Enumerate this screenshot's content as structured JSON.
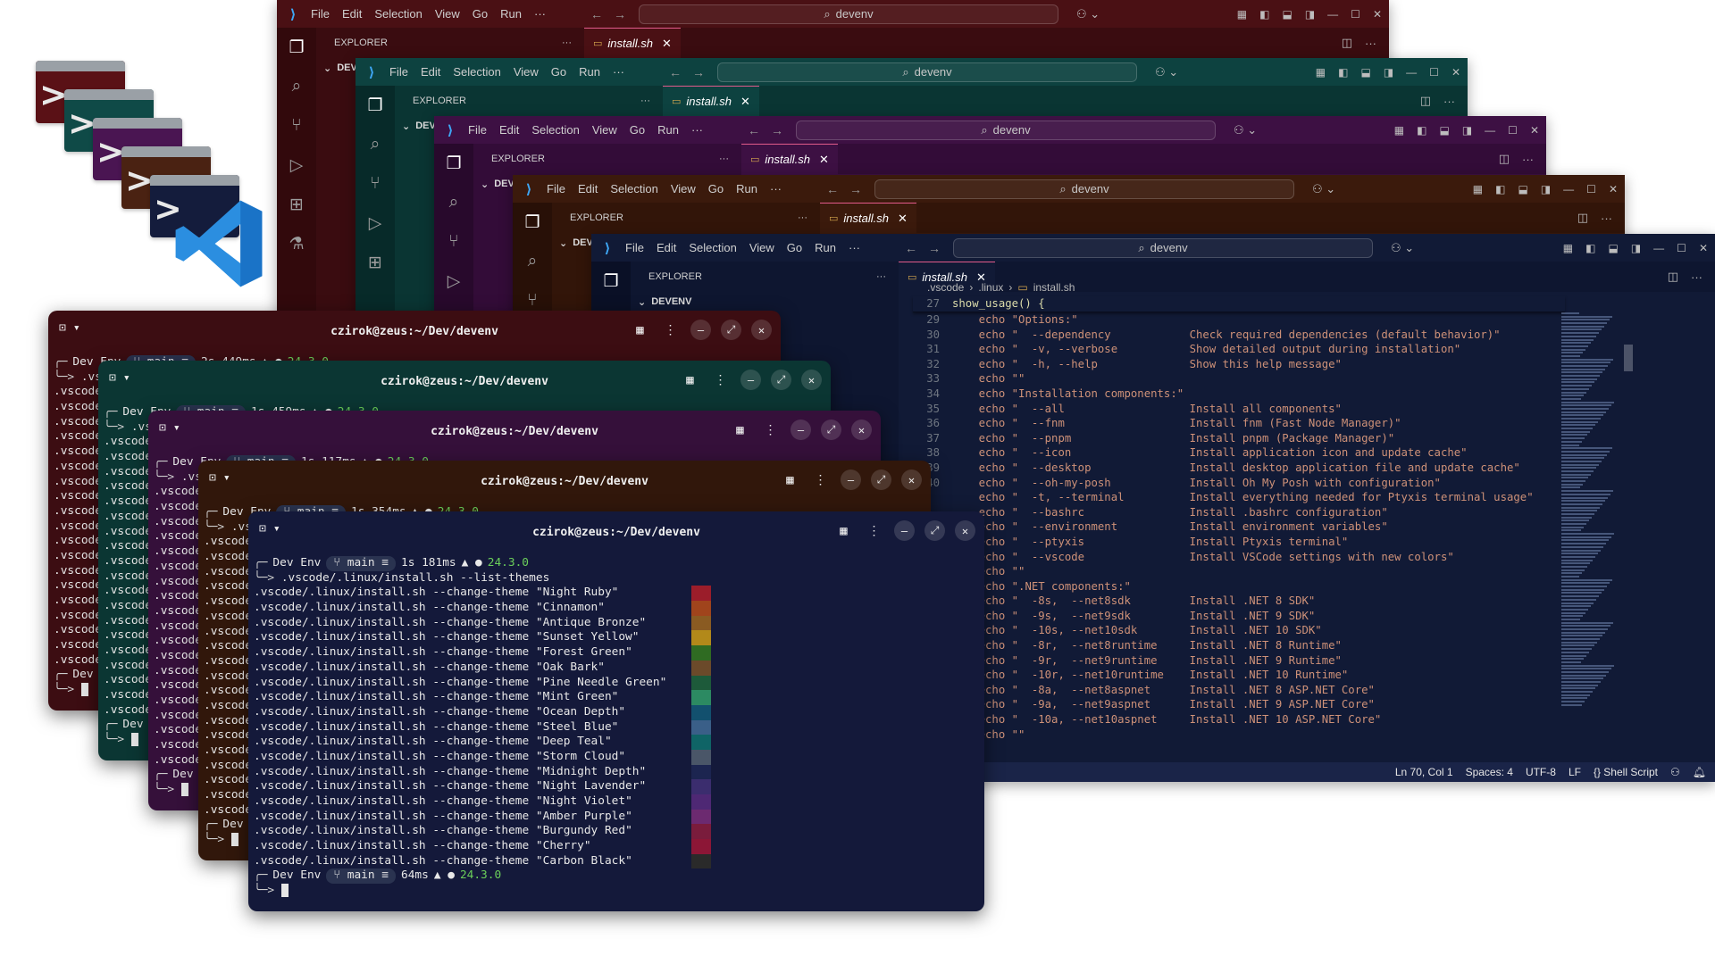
{
  "vscode": {
    "menu": [
      "File",
      "Edit",
      "Selection",
      "View",
      "Go",
      "Run"
    ],
    "more": "···",
    "search": "devenv",
    "explorer_title": "EXPLORER",
    "explorer_root": "DEVENV",
    "explorer_root_short": "DEVE",
    "tab_label": "install.sh",
    "breadcrumb": [
      ".vscode",
      ".linux",
      "install.sh"
    ],
    "sticky_line": {
      "num": "27",
      "text": "show_usage() {"
    },
    "code": [
      {
        "n": "29",
        "o": "echo \"Options:\"",
        "d": ""
      },
      {
        "n": "30",
        "o": "echo \"  --dependency",
        "d": "Check required dependencies (default behavior)\""
      },
      {
        "n": "31",
        "o": "echo \"  -v, --verbose",
        "d": "Show detailed output during installation\""
      },
      {
        "n": "32",
        "o": "echo \"  -h, --help",
        "d": "Show this help message\""
      },
      {
        "n": "33",
        "o": "echo \"\"",
        "d": ""
      },
      {
        "n": "34",
        "o": "echo \"Installation components:\"",
        "d": ""
      },
      {
        "n": "35",
        "o": "echo \"  --all",
        "d": "Install all components\""
      },
      {
        "n": "36",
        "o": "echo \"  --fnm",
        "d": "Install fnm (Fast Node Manager)\""
      },
      {
        "n": "37",
        "o": "echo \"  --pnpm",
        "d": "Install pnpm (Package Manager)\""
      },
      {
        "n": "38",
        "o": "echo \"  --icon",
        "d": "Install application icon and update cache\""
      },
      {
        "n": "39",
        "o": "echo \"  --desktop",
        "d": "Install desktop application file and update cache\""
      },
      {
        "n": "40",
        "o": "echo \"  --oh-my-posh",
        "d": "Install Oh My Posh with configuration\""
      },
      {
        "n": "",
        "o": "echo \"  -t, --terminal",
        "d": "Install everything needed for Ptyxis terminal usage\""
      },
      {
        "n": "",
        "o": "echo \"  --bashrc",
        "d": "Install .bashrc configuration\""
      },
      {
        "n": "",
        "o": "echo \"  --environment",
        "d": "Install environment variables\""
      },
      {
        "n": "",
        "o": "echo \"  --ptyxis",
        "d": "Install Ptyxis terminal\""
      },
      {
        "n": "",
        "o": "echo \"  --vscode",
        "d": "Install VSCode settings with new colors\""
      },
      {
        "n": "",
        "o": "echo \"\"",
        "d": ""
      },
      {
        "n": "",
        "o": "echo \".NET components:\"",
        "d": ""
      },
      {
        "n": "",
        "o": "echo \"  -8s,  --net8sdk",
        "d": "Install .NET 8 SDK\""
      },
      {
        "n": "",
        "o": "echo \"  -9s,  --net9sdk",
        "d": "Install .NET 9 SDK\""
      },
      {
        "n": "",
        "o": "echo \"  -10s, --net10sdk",
        "d": "Install .NET 10 SDK\""
      },
      {
        "n": "",
        "o": "echo \"  -8r,  --net8runtime",
        "d": "Install .NET 8 Runtime\""
      },
      {
        "n": "",
        "o": "echo \"  -9r,  --net9runtime",
        "d": "Install .NET 9 Runtime\""
      },
      {
        "n": "",
        "o": "echo \"  -10r, --net10runtime",
        "d": "Install .NET 10 Runtime\""
      },
      {
        "n": "",
        "o": "echo \"  -8a,  --net8aspnet",
        "d": "Install .NET 8 ASP.NET Core\""
      },
      {
        "n": "",
        "o": "echo \"  -9a,  --net9aspnet",
        "d": "Install .NET 9 ASP.NET Core\""
      },
      {
        "n": "",
        "o": "echo \"  -10a, --net10aspnet",
        "d": "Install .NET 10 ASP.NET Core\""
      },
      {
        "n": "",
        "o": "echo \"\"",
        "d": ""
      }
    ],
    "status": {
      "position": "Ln 70, Col 1",
      "spaces": "Spaces: 4",
      "encoding": "UTF-8",
      "eol": "LF",
      "language": "{} Shell Script"
    }
  },
  "terminal": {
    "title": "czirok@zeus:~/Dev/devenv",
    "prompt_dir": "Dev Env",
    "prompt_branch": "main ≡",
    "node_version": "24.3.0",
    "times": [
      "2s 449ms",
      "1s 459ms",
      "1s 117ms",
      "1s 354ms",
      "1s 181ms",
      "64ms"
    ],
    "command": ".vscode/.linux/install.sh --list-themes",
    "partial": ".vscode",
    "theme_prefix": ".vscode/.linux/install.sh --change-theme",
    "themes": [
      "Night Ruby",
      "Cinnamon",
      "Antique Bronze",
      "Sunset Yellow",
      "Forest Green",
      "Oak Bark",
      "Pine Needle Green",
      "Mint Green",
      "Ocean Depth",
      "Steel Blue",
      "Deep Teal",
      "Storm Cloud",
      "Midnight Depth",
      "Night Lavender",
      "Night Violet",
      "Amber Purple",
      "Burgundy Red",
      "Cherry",
      "Carbon Black"
    ],
    "theme_colors": [
      "#9b1d2a",
      "#a0441c",
      "#8a5b22",
      "#b2891a",
      "#2f6b22",
      "#6b4a2a",
      "#1d5a3a",
      "#2c8a62",
      "#12506e",
      "#3a5f88",
      "#0f6466",
      "#4a5668",
      "#1c2550",
      "#3b2d6e",
      "#4e2874",
      "#6c2a70",
      "#7a1c3c",
      "#8c1636",
      "#2a2a2a"
    ]
  },
  "colors": {
    "vs1": "#4a1014",
    "vs1_dark": "#32090c",
    "vs2": "#0d4240",
    "vs2_dark": "#072a29",
    "vs3": "#3d1043",
    "vs3_dark": "#28092c",
    "vs4": "#3b1a0c",
    "vs4_dark": "#281007",
    "vs5": "#111a36",
    "vs5_dark": "#0a1026",
    "t1": "#3c0d12",
    "t2": "#0b3633",
    "t3": "#35103a",
    "t4": "#31170b",
    "t5": "#14193a",
    "status_bar": "#1a2448"
  }
}
